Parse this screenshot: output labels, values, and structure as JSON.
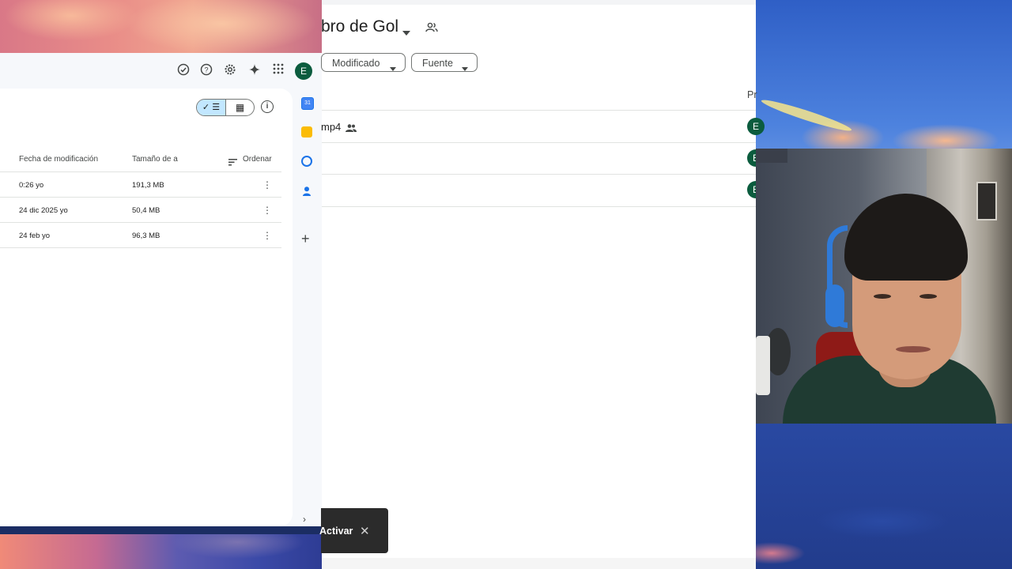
{
  "left_window": {
    "header_icons": [
      "check-circle-icon",
      "help-icon",
      "settings-icon",
      "gemini-sparkle-icon",
      "apps-grid-icon"
    ],
    "avatar_letter": "E",
    "view_toggle": {
      "list_icon": "check-list-icon",
      "grid_icon": "grid-icon"
    },
    "columns": {
      "modified": "Fecha de modificación",
      "size": "Tamaño de a",
      "sort": "Ordenar"
    },
    "rows": [
      {
        "modified": "0:26 yo",
        "size": "191,3 MB"
      },
      {
        "modified": "24 dic 2025 yo",
        "size": "50,4 MB"
      },
      {
        "modified": "24 feb yo",
        "size": "96,3 MB"
      }
    ],
    "side_rail": [
      "calendar-icon",
      "keep-icon",
      "tasks-icon",
      "contacts-icon",
      "add-icon"
    ],
    "calendar_day": "31"
  },
  "middle_window": {
    "folder_title": "bro de Gol",
    "filters": {
      "modified": "Modificado",
      "source": "Fuente"
    },
    "column_owner_partial": "Pr",
    "rows": [
      {
        "name": "mp4",
        "shared": true,
        "owner_letter": "E"
      },
      {
        "name": "",
        "shared": false,
        "owner_letter": "E"
      },
      {
        "name": "",
        "shared": false,
        "owner_letter": "E"
      }
    ],
    "snackbar": {
      "action": "Activar"
    }
  }
}
